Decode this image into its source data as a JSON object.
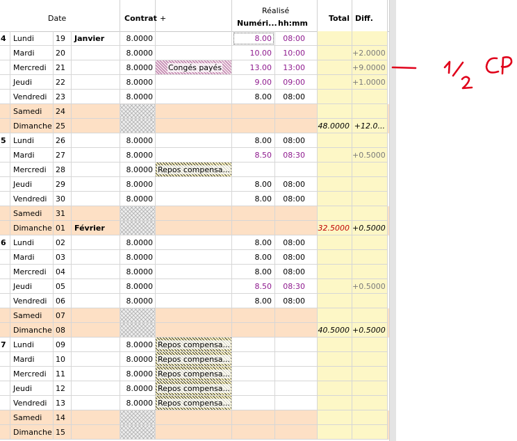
{
  "header": {
    "date": "Date",
    "contrat": "Contrat",
    "plus": "+",
    "realise": "Réalisé",
    "numerique": "Numéri...",
    "hhmm": "hh:mm",
    "total": "Total",
    "diff": "Diff."
  },
  "rows": [
    {
      "wk": "4",
      "day": "Lundi",
      "num": "19",
      "month": "Janvier",
      "contrat": "8.0000",
      "num_val": "8.00",
      "hhmm": "08:00",
      "purple": true
    },
    {
      "day": "Mardi",
      "num": "20",
      "contrat": "8.0000",
      "num_val": "10.00",
      "hhmm": "10:00",
      "purple": true,
      "diff": "+2.0000"
    },
    {
      "day": "Mercredi",
      "num": "21",
      "contrat": "8.0000",
      "activity": "Congés payés",
      "act_style": "pink",
      "num_val": "13.00",
      "hhmm": "13:00",
      "purple": true,
      "diff": "+9.0000"
    },
    {
      "day": "Jeudi",
      "num": "22",
      "contrat": "8.0000",
      "num_val": "9.00",
      "hhmm": "09:00",
      "purple": true,
      "diff": "+1.0000"
    },
    {
      "day": "Vendredi",
      "num": "23",
      "contrat": "8.0000",
      "num_val": "8.00",
      "hhmm": "08:00"
    },
    {
      "day": "Samedi",
      "num": "24",
      "weekend": true
    },
    {
      "day": "Dimanche",
      "num": "25",
      "weekend": true,
      "total": "48.0000",
      "diff": "+12.0...",
      "diff_bold": false,
      "diff_italic": true
    },
    {
      "wk": "5",
      "day": "Lundi",
      "num": "26",
      "contrat": "8.0000",
      "num_val": "8.00",
      "hhmm": "08:00"
    },
    {
      "day": "Mardi",
      "num": "27",
      "contrat": "8.0000",
      "num_val": "8.50",
      "hhmm": "08:30",
      "purple": true,
      "diff": "+0.5000"
    },
    {
      "day": "Mercredi",
      "num": "28",
      "contrat": "8.0000",
      "activity": "Repos compensa...",
      "act_style": "yellow"
    },
    {
      "day": "Jeudi",
      "num": "29",
      "contrat": "8.0000",
      "num_val": "8.00",
      "hhmm": "08:00"
    },
    {
      "day": "Vendredi",
      "num": "30",
      "contrat": "8.0000",
      "num_val": "8.00",
      "hhmm": "08:00"
    },
    {
      "day": "Samedi",
      "num": "31",
      "weekend": true
    },
    {
      "day": "Dimanche",
      "num": "01",
      "month": "Février",
      "weekend": true,
      "total": "32.5000",
      "total_red": true,
      "diff": "+0.5000",
      "diff_italic": true
    },
    {
      "wk": "6",
      "day": "Lundi",
      "num": "02",
      "contrat": "8.0000",
      "num_val": "8.00",
      "hhmm": "08:00"
    },
    {
      "day": "Mardi",
      "num": "03",
      "contrat": "8.0000",
      "num_val": "8.00",
      "hhmm": "08:00"
    },
    {
      "day": "Mercredi",
      "num": "04",
      "contrat": "8.0000",
      "num_val": "8.00",
      "hhmm": "08:00"
    },
    {
      "day": "Jeudi",
      "num": "05",
      "contrat": "8.0000",
      "num_val": "8.50",
      "hhmm": "08:30",
      "purple": true,
      "diff": "+0.5000"
    },
    {
      "day": "Vendredi",
      "num": "06",
      "contrat": "8.0000",
      "num_val": "8.00",
      "hhmm": "08:00"
    },
    {
      "day": "Samedi",
      "num": "07",
      "weekend": true
    },
    {
      "day": "Dimanche",
      "num": "08",
      "weekend": true,
      "total": "40.5000",
      "diff": "+0.5000",
      "diff_italic": true
    },
    {
      "wk": "7",
      "day": "Lundi",
      "num": "09",
      "contrat": "8.0000",
      "activity": "Repos compensa...",
      "act_style": "yellow"
    },
    {
      "day": "Mardi",
      "num": "10",
      "contrat": "8.0000",
      "activity": "Repos compensa...",
      "act_style": "yellow"
    },
    {
      "day": "Mercredi",
      "num": "11",
      "contrat": "8.0000",
      "activity": "Repos compensa...",
      "act_style": "yellow"
    },
    {
      "day": "Jeudi",
      "num": "12",
      "contrat": "8.0000",
      "activity": "Repos compensa...",
      "act_style": "yellow"
    },
    {
      "day": "Vendredi",
      "num": "13",
      "contrat": "8.0000",
      "activity": "Repos compensa...",
      "act_style": "yellow"
    },
    {
      "day": "Samedi",
      "num": "14",
      "weekend": true
    },
    {
      "day": "Dimanche",
      "num": "15",
      "weekend": true
    }
  ],
  "annotation": {
    "text": "1/2 CP",
    "color": "#e0001a"
  },
  "colors": {
    "weekend": "#fde0c5",
    "total_column": "#fdf7c6",
    "purple_value": "#8e1a8e",
    "red_total": "#c00000"
  }
}
